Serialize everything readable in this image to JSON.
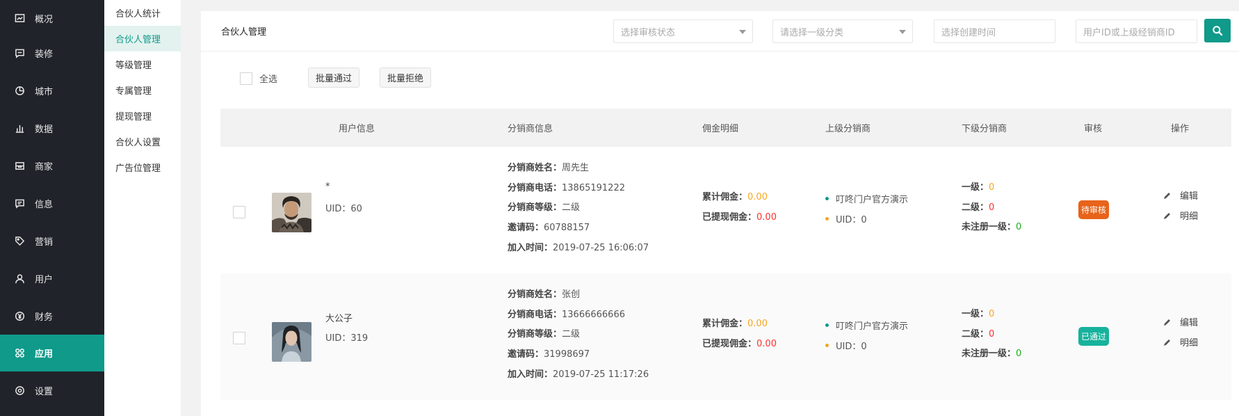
{
  "colors": {
    "accent": "#0f9a8a",
    "sidebar_bg": "#20232a",
    "pending": "#e8631a",
    "approved": "#17b29c",
    "orange": "#f5a623",
    "red": "#ff2f2f",
    "green": "#1aad19"
  },
  "sidebar": {
    "items": [
      {
        "label": "概况",
        "icon": "overview-icon"
      },
      {
        "label": "装修",
        "icon": "decorate-icon"
      },
      {
        "label": "城市",
        "icon": "city-icon"
      },
      {
        "label": "数据",
        "icon": "data-chart-icon"
      },
      {
        "label": "商家",
        "icon": "merchant-icon"
      },
      {
        "label": "信息",
        "icon": "message-icon"
      },
      {
        "label": "营销",
        "icon": "tag-icon"
      },
      {
        "label": "用户",
        "icon": "user-icon"
      },
      {
        "label": "财务",
        "icon": "yen-icon"
      },
      {
        "label": "应用",
        "icon": "apps-icon",
        "active": true
      },
      {
        "label": "设置",
        "icon": "gear-icon"
      }
    ]
  },
  "submenu": {
    "items": [
      {
        "label": "合伙人统计"
      },
      {
        "label": "合伙人管理",
        "active": true
      },
      {
        "label": "等级管理"
      },
      {
        "label": "专属管理"
      },
      {
        "label": "提现管理"
      },
      {
        "label": "合伙人设置"
      },
      {
        "label": "广告位管理"
      }
    ]
  },
  "header": {
    "title": "合伙人管理",
    "filters": {
      "audit_status_placeholder": "选择审核状态",
      "category_placeholder": "请选择一级分类",
      "created_time_placeholder": "选择创建时间",
      "user_id_placeholder": "用户ID或上级经销商ID"
    }
  },
  "toolbar": {
    "select_all_label": "全选",
    "batch_approve_label": "批量通过",
    "batch_reject_label": "批量拒绝"
  },
  "table": {
    "columns": [
      "用户信息",
      "分销商信息",
      "佣金明细",
      "上级分销商",
      "下级分销商",
      "审核",
      "操作"
    ],
    "labels": {
      "name": "分销商姓名：",
      "phone": "分销商电话：",
      "level": "分销商等级：",
      "invite": "邀请码：",
      "join_time": "加入时间：",
      "total_commission": "累计佣金：",
      "withdrawn_commission": "已提现佣金：",
      "lower_level1": "一级：",
      "lower_level2": "二级：",
      "unregistered_level1": "未注册一级：",
      "edit": "编辑",
      "detail": "明细"
    },
    "rows": [
      {
        "username": "*",
        "uid": "UID：60",
        "name": "周先生",
        "phone": "13865191222",
        "level": "二级",
        "invite": "60788157",
        "join_time": "2019-07-25 16:06:07",
        "total_commission": "0.00",
        "withdrawn_commission": "0.00",
        "parent_name": "叮咚门户官方演示",
        "parent_uid": "UID：0",
        "lower_level1": "0",
        "lower_level2": "0",
        "unregistered_level1": "0",
        "status": "待审核"
      },
      {
        "username": "大公子",
        "uid": "UID：319",
        "name": "张创",
        "phone": "13666666666",
        "level": "二级",
        "invite": "31998697",
        "join_time": "2019-07-25 11:17:26",
        "total_commission": "0.00",
        "withdrawn_commission": "0.00",
        "parent_name": "叮咚门户官方演示",
        "parent_uid": "UID：0",
        "lower_level1": "0",
        "lower_level2": "0",
        "unregistered_level1": "0",
        "status": "已通过"
      }
    ]
  }
}
